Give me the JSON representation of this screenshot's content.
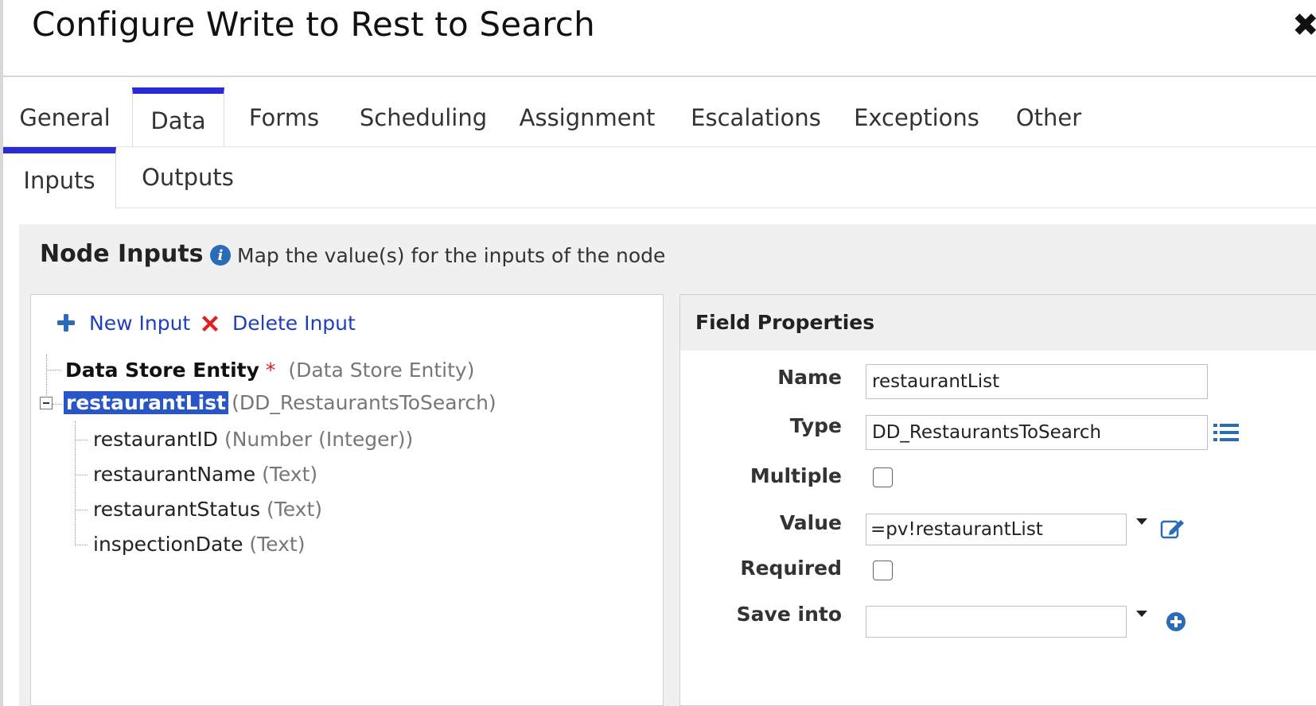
{
  "dialog": {
    "title": "Configure Write to Rest to Search",
    "close_glyph": "✖"
  },
  "tabs": [
    {
      "label": "General"
    },
    {
      "label": "Data",
      "active": true
    },
    {
      "label": "Forms"
    },
    {
      "label": "Scheduling"
    },
    {
      "label": "Assignment"
    },
    {
      "label": "Escalations"
    },
    {
      "label": "Exceptions"
    },
    {
      "label": "Other"
    }
  ],
  "subtabs": [
    {
      "label": "Inputs",
      "active": true
    },
    {
      "label": "Outputs"
    }
  ],
  "node_inputs": {
    "title": "Node Inputs",
    "hint": "Map the value(s) for the inputs of the node",
    "info_icon_glyph": "i"
  },
  "toolbar": {
    "new_label": "New Input",
    "delete_label": "Delete Input"
  },
  "tree": {
    "root_items": [
      {
        "name": "Data Store Entity",
        "required_mark": "*",
        "type": "(Data Store Entity)"
      },
      {
        "name": "restaurantList",
        "type": "(DD_RestaurantsToSearch)",
        "selected": true
      }
    ],
    "children": [
      {
        "name": "restaurantID",
        "type": "(Number (Integer))"
      },
      {
        "name": "restaurantName",
        "type": "(Text)"
      },
      {
        "name": "restaurantStatus",
        "type": "(Text)"
      },
      {
        "name": "inspectionDate",
        "type": "(Text)"
      }
    ]
  },
  "field_properties": {
    "title": "Field Properties",
    "name_label": "Name",
    "name_value": "restaurantList",
    "type_label": "Type",
    "type_value": "DD_RestaurantsToSearch",
    "multiple_label": "Multiple",
    "multiple_checked": false,
    "value_label": "Value",
    "value_value": "=pv!restaurantList",
    "required_label": "Required",
    "required_checked": false,
    "save_into_label": "Save into",
    "save_into_value": ""
  },
  "colors": {
    "accent_tab": "#2b2bd6",
    "link": "#1f3fbf",
    "selected_bg": "#2956c7",
    "icon_blue": "#2c6bb8",
    "delete_red": "#e0201e"
  }
}
